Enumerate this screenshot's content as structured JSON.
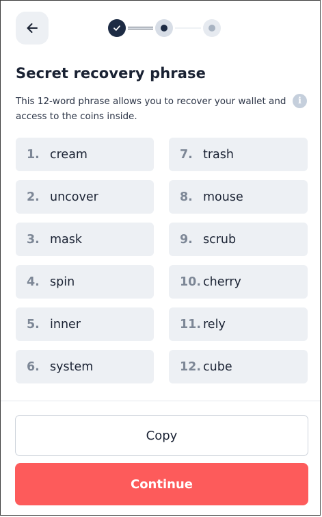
{
  "header": {
    "back_icon": "arrow-left-icon",
    "steps": [
      {
        "state": "completed",
        "icon": "check-icon"
      },
      {
        "state": "current"
      },
      {
        "state": "upcoming"
      }
    ]
  },
  "content": {
    "title": "Secret recovery phrase",
    "description": "This 12-word phrase allows you to recover your wallet and access to the coins inside.",
    "info_icon": "info-icon",
    "words": [
      {
        "num": "1.",
        "word": "cream"
      },
      {
        "num": "7.",
        "word": "trash"
      },
      {
        "num": "2.",
        "word": "uncover"
      },
      {
        "num": "8.",
        "word": "mouse"
      },
      {
        "num": "3.",
        "word": "mask"
      },
      {
        "num": "9.",
        "word": "scrub"
      },
      {
        "num": "4.",
        "word": "spin"
      },
      {
        "num": "10.",
        "word": "cherry"
      },
      {
        "num": "5.",
        "word": "inner"
      },
      {
        "num": "11.",
        "word": "rely"
      },
      {
        "num": "6.",
        "word": "system"
      },
      {
        "num": "12.",
        "word": "cube"
      }
    ]
  },
  "footer": {
    "copy_label": "Copy",
    "continue_label": "Continue"
  },
  "colors": {
    "primary": "#fd5b5b",
    "dark": "#1d2b44",
    "tile": "#edf0f4"
  }
}
